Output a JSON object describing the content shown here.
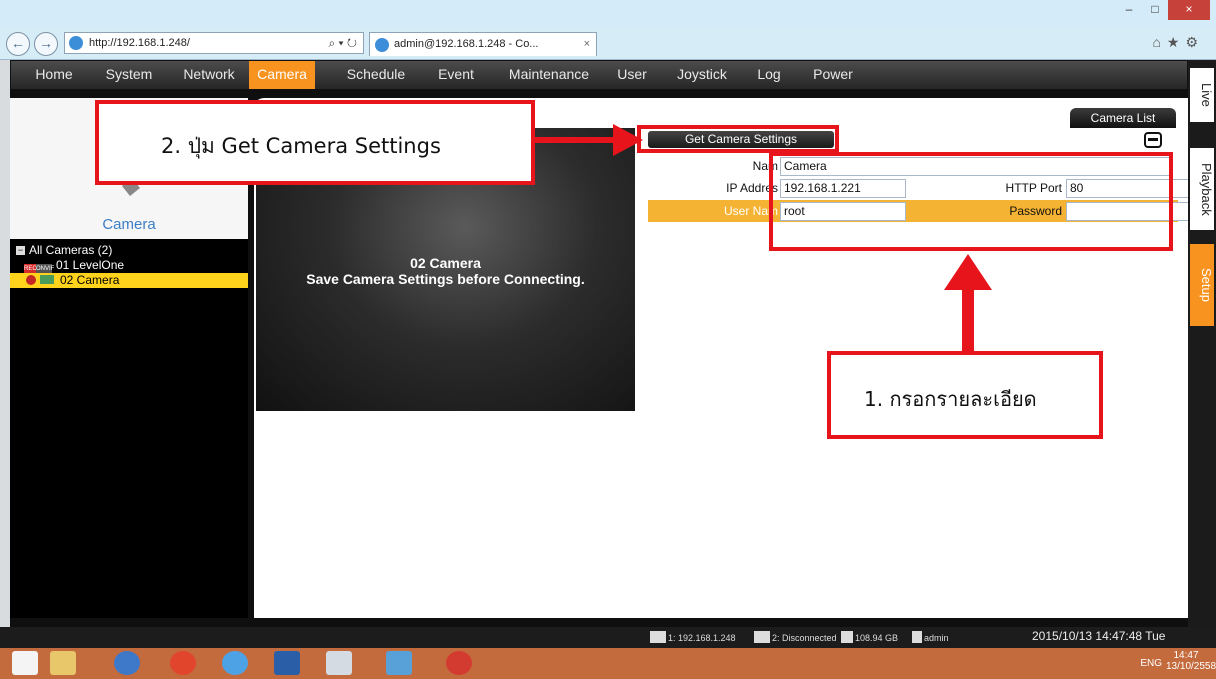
{
  "browser": {
    "url": "http://192.168.1.248/",
    "address_tools": "⌕ ▾ ↻",
    "tab_title": "admin@192.168.1.248 - Co...",
    "tab_close": "×",
    "back": "←",
    "forward": "→",
    "right_tools": "⌂★⚙",
    "window_min": "–",
    "window_max": "□",
    "window_close": "×"
  },
  "menu": {
    "items": [
      "Home",
      "System",
      "Network",
      "Camera",
      "Schedule",
      "Event",
      "Maintenance",
      "User",
      "Joystick",
      "Log",
      "Power"
    ],
    "active": "Camera"
  },
  "left": {
    "title": "Camera",
    "tree": {
      "root": "All Cameras (2)",
      "items": [
        {
          "label": "01  LevelOne",
          "badges": [
            "REC",
            "ONVIF"
          ]
        },
        {
          "label": "02  Camera",
          "selected": true
        }
      ]
    }
  },
  "preview": {
    "line1": "02 Camera",
    "line2": "Save Camera Settings before Connecting."
  },
  "camera_list_button": "Camera List",
  "get_settings_button": "Get Camera Settings",
  "form": {
    "name_label": "Nam",
    "name_value": "Camera",
    "ip_label": "IP Addres",
    "ip_value": "192.168.1.221",
    "port_label": "HTTP Port",
    "port_value": "80",
    "user_label": "User Nam",
    "user_value": "root",
    "password_label": "Password",
    "password_value": ""
  },
  "side_tabs": [
    "Live",
    "Playback",
    "Setup"
  ],
  "status": {
    "server": "1: 192.168.1.248",
    "connection": "2: Disconnected",
    "disk": "108.94 GB",
    "user": "admin",
    "datetime": "2015/10/13 14:47:48 Tue"
  },
  "taskbar": {
    "lang": "ENG",
    "time": "14:47",
    "date": "13/10/2558"
  },
  "annotations": {
    "step2": "2. ปุ่ม Get Camera Settings",
    "step1": "1. กรอกรายละเอียด"
  },
  "colors": {
    "accent": "#f7931e",
    "selection": "#ffd21c",
    "annotation_red": "#e8141b",
    "link_blue": "#3c7ec5"
  }
}
